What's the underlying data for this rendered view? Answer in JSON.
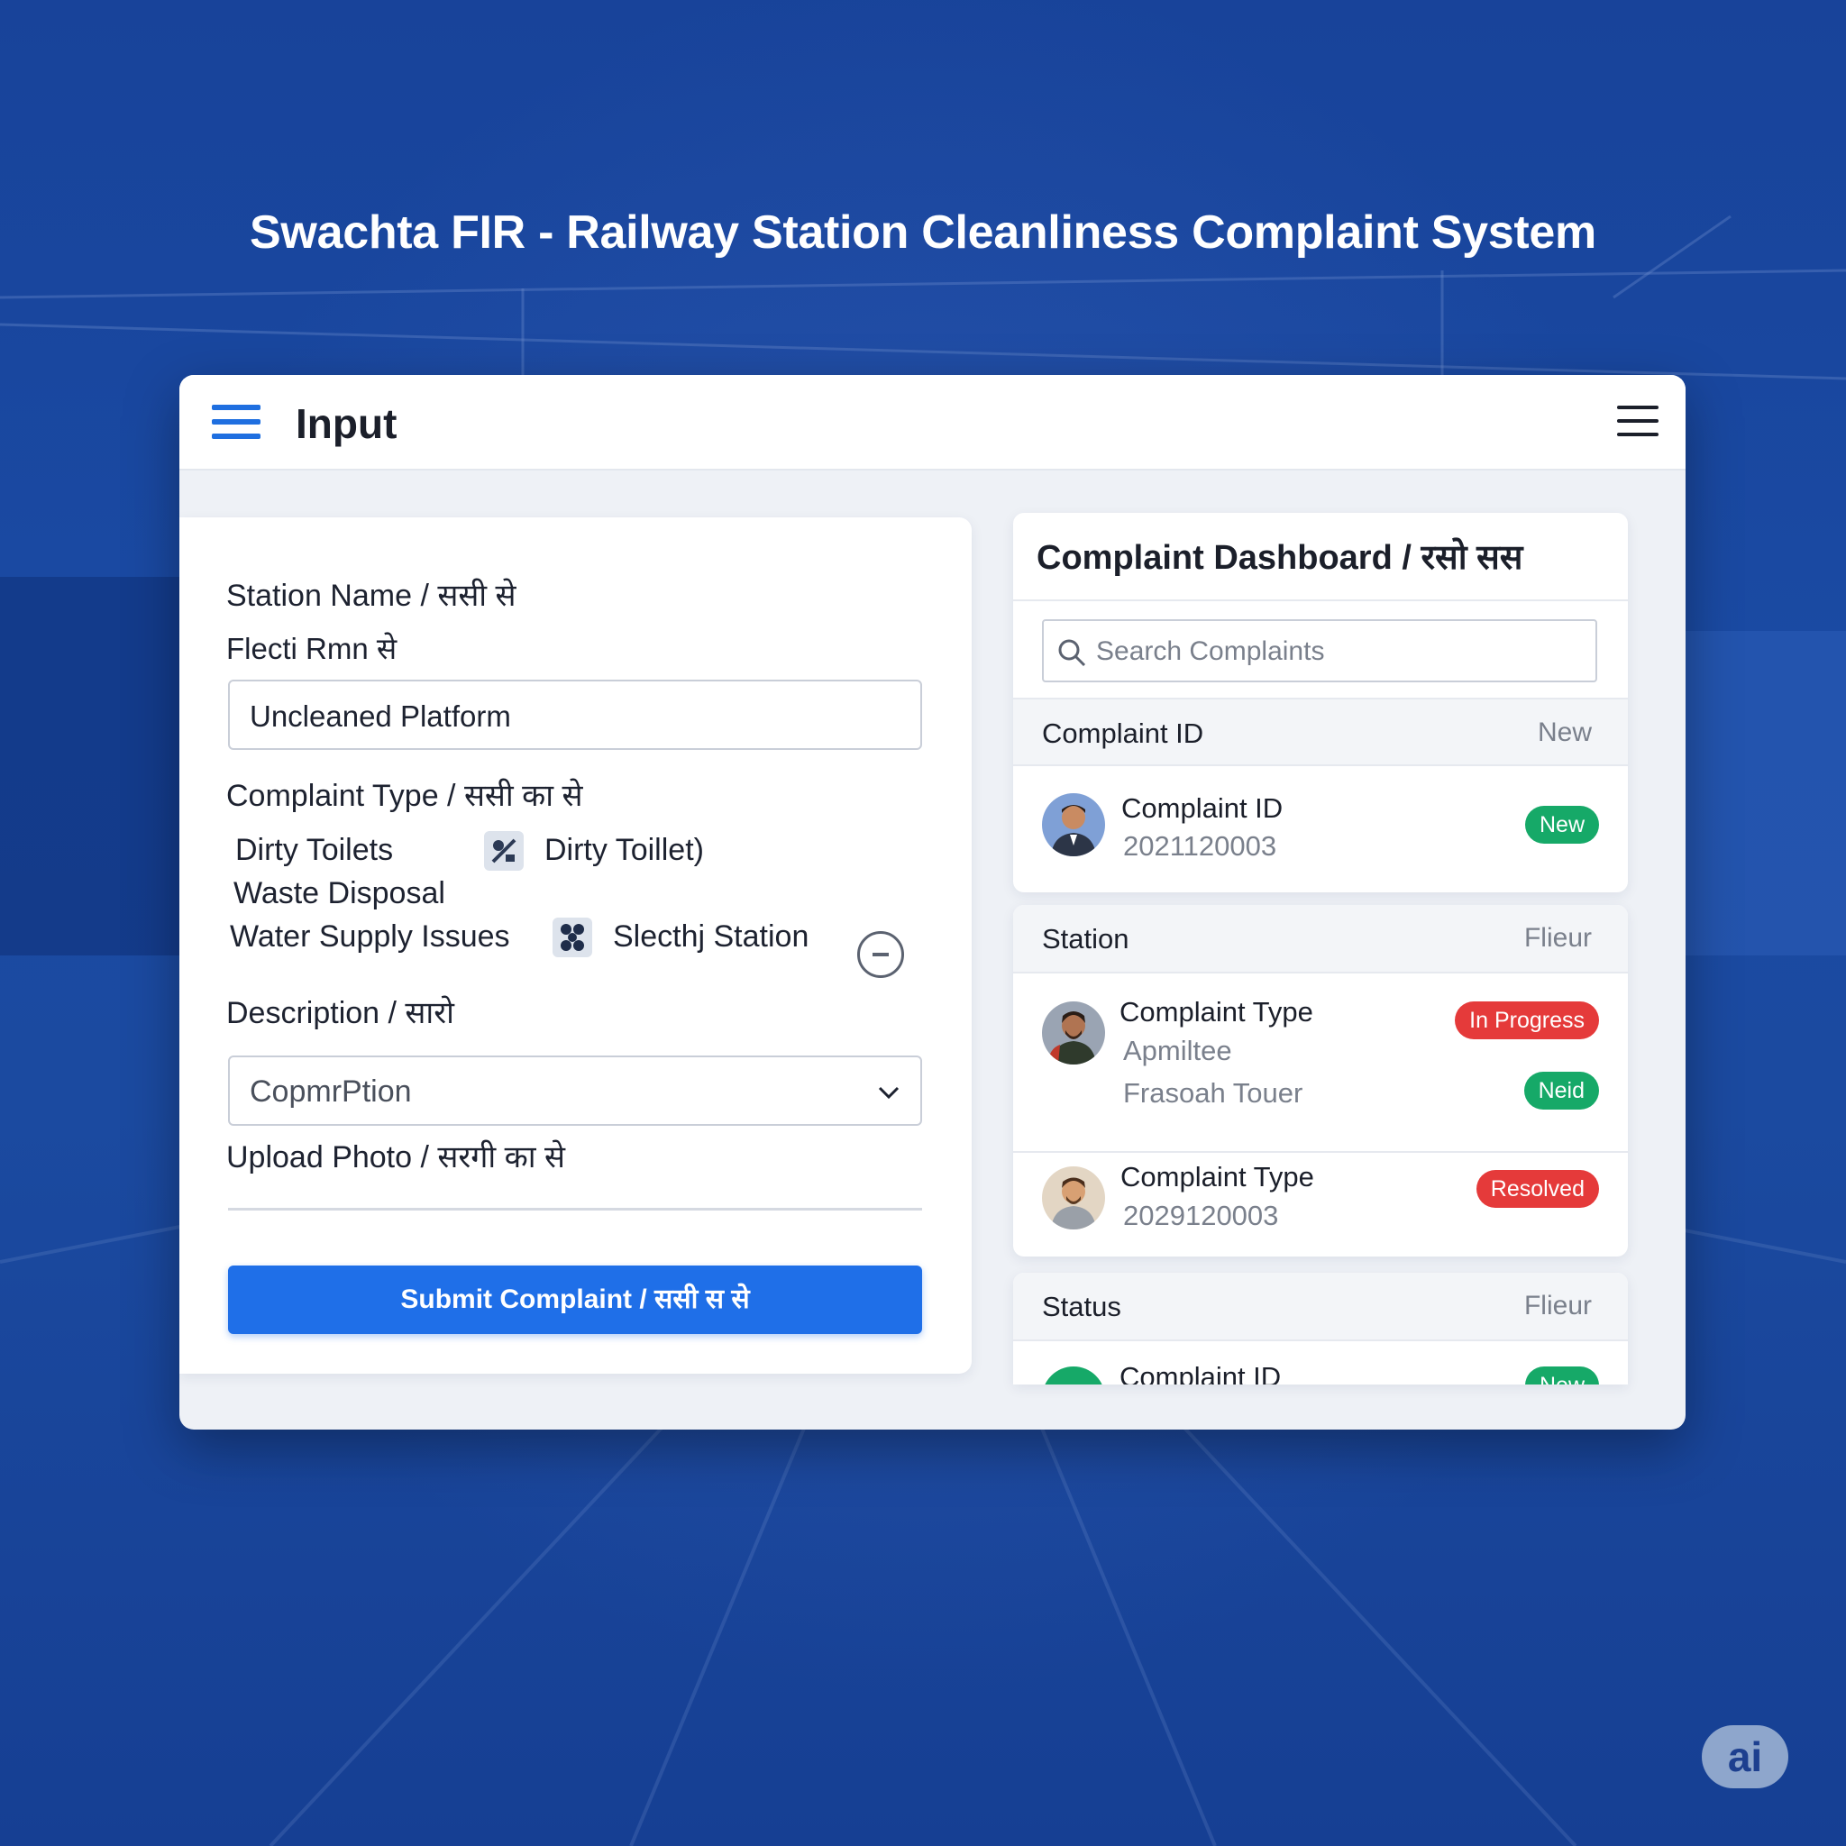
{
  "page": {
    "title": "Swachta FIR - Railway Station Cleanliness Complaint System"
  },
  "topbar": {
    "title": "Input"
  },
  "form": {
    "station_label": "Station Name / ससी से",
    "station_sublabel": "Flecti Rmn से",
    "station_value": "Uncleaned Platform",
    "type_label": "Complaint Type / ससी का से",
    "options": [
      "Dirty Toilets",
      "Dirty Toillet)",
      "Waste Disposal",
      "Water Supply Issues",
      "Slecthj Station"
    ],
    "description_label": "Description / सारो",
    "description_value": "CopmrPtion",
    "upload_label": "Upload Photo / सरगी का से",
    "submit_label": "Submit Complaint / ससी स से"
  },
  "dashboard": {
    "title": "Complaint Dashboard / रसो सस",
    "search_placeholder": "Search Complaints",
    "sections": [
      {
        "header": "Complaint ID",
        "header_right": "New",
        "rows": [
          {
            "title": "Complaint ID",
            "lines": [
              "2021120003"
            ],
            "badges": [
              "New"
            ]
          }
        ]
      },
      {
        "header": "Station",
        "header_right": "Flieur",
        "rows": [
          {
            "title": "Complaint Type",
            "lines": [
              "Apmiltee",
              "Frasoah Touer"
            ],
            "badges": [
              "In Progress",
              "Neid"
            ]
          },
          {
            "title": "Complaint Type",
            "lines": [
              "2029120003"
            ],
            "badges": [
              "Resolved"
            ]
          }
        ]
      },
      {
        "header": "Status",
        "header_right": "Flieur",
        "rows": [
          {
            "title": "Complaint ID",
            "lines": [],
            "badges": [
              "New"
            ]
          }
        ]
      }
    ]
  },
  "watermark": {
    "label": "ai"
  },
  "colors": {
    "background": "#1a4aa3",
    "primary": "#1f6fe8",
    "success": "#16a968",
    "danger": "#e53a3a"
  }
}
